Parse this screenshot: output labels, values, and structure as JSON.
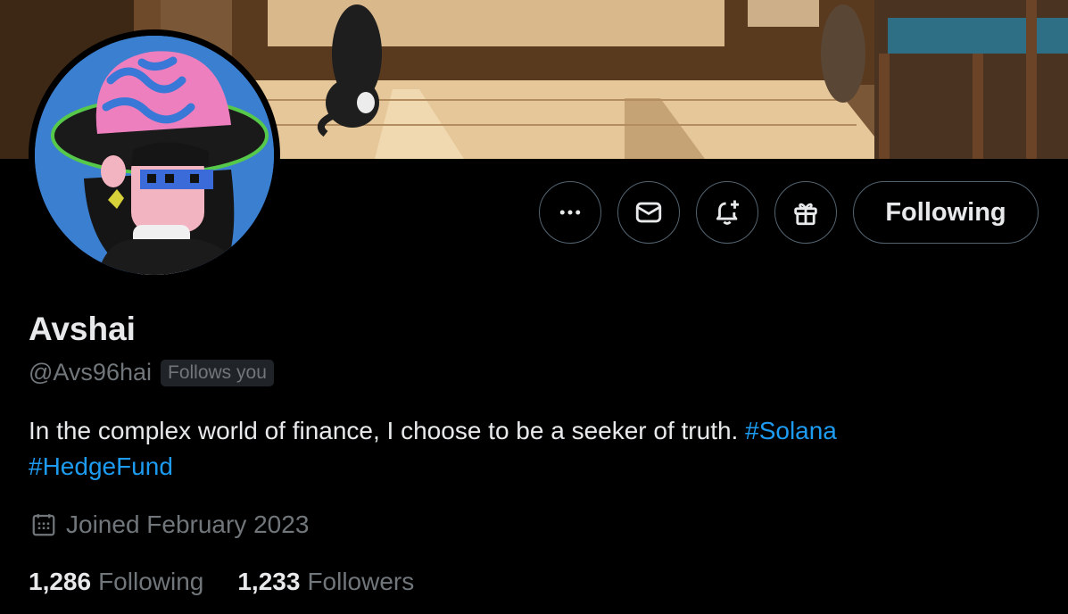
{
  "profile": {
    "display_name": "Avshai",
    "handle": "@Avs96hai",
    "follows_you_badge": "Follows you",
    "bio_text": "In the complex world of finance, I choose to be a seeker of truth.",
    "bio_hashtags": [
      "#Solana",
      "#HedgeFund"
    ],
    "joined_text": "Joined February 2023"
  },
  "stats": {
    "following_count": "1,286",
    "following_label": "Following",
    "followers_count": "1,233",
    "followers_label": "Followers"
  },
  "actions": {
    "more_icon": "more-horizontal-icon",
    "message_icon": "envelope-icon",
    "notify_icon": "bell-plus-icon",
    "gift_icon": "gift-icon",
    "follow_label": "Following"
  },
  "colors": {
    "background": "#000000",
    "text_primary": "#e7e9ea",
    "text_secondary": "#71767b",
    "link": "#1d9bf0",
    "button_border": "#536471"
  }
}
